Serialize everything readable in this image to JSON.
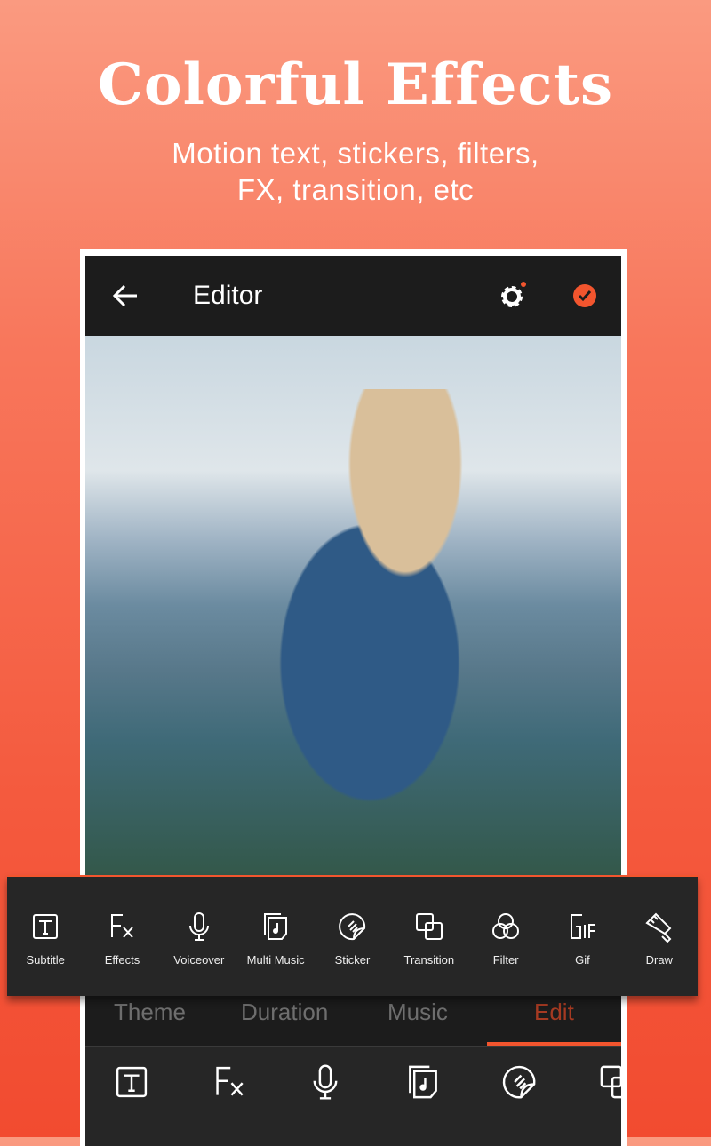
{
  "promo": {
    "title": "Colorful Effects",
    "subtitle_line1": "Motion text, stickers, filters,",
    "subtitle_line2": "FX, transition, etc"
  },
  "editor": {
    "title": "Editor",
    "accent": "#f2552e"
  },
  "tabs": [
    "Theme",
    "Duration",
    "Music",
    "Edit"
  ],
  "toolbar": [
    {
      "label": "Subtitle",
      "icon": "text-box-icon"
    },
    {
      "label": "Effects",
      "icon": "fx-icon"
    },
    {
      "label": "Voiceover",
      "icon": "microphone-icon"
    },
    {
      "label": "Multi Music",
      "icon": "music-file-icon"
    },
    {
      "label": "Sticker",
      "icon": "sticker-icon"
    },
    {
      "label": "Transition",
      "icon": "transition-icon"
    },
    {
      "label": "Filter",
      "icon": "filter-icon"
    },
    {
      "label": "Gif",
      "icon": "gif-icon"
    },
    {
      "label": "Draw",
      "icon": "brush-icon"
    }
  ]
}
